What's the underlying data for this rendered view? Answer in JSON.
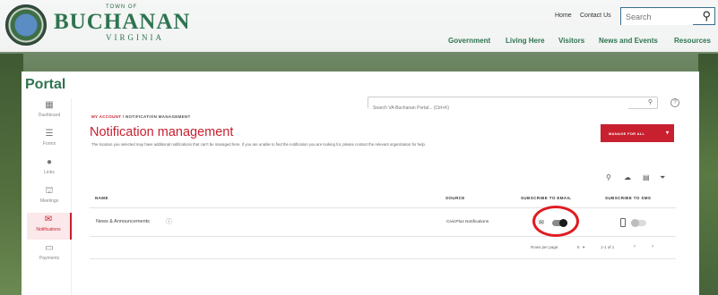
{
  "header": {
    "town_of": "TOWN OF",
    "brand": "BUCHANAN",
    "state": "VIRGINIA",
    "utility": [
      "Home",
      "Contact Us"
    ],
    "search_placeholder": "Search",
    "nav": [
      "Government",
      "Living Here",
      "Visitors",
      "News and Events",
      "Resources"
    ]
  },
  "portal": {
    "title": "Portal",
    "sidebar": [
      {
        "label": "Dashboard",
        "icon": "dashboard-icon",
        "glyph": "▦"
      },
      {
        "label": "Forms",
        "icon": "forms-icon",
        "glyph": "☰"
      },
      {
        "label": "Links",
        "icon": "links-icon",
        "glyph": "●"
      },
      {
        "label": "Meetings",
        "icon": "meetings-icon",
        "glyph": "⛫"
      },
      {
        "label": "Notifications",
        "icon": "notifications-icon",
        "glyph": "✉"
      },
      {
        "label": "Payments",
        "icon": "payments-icon",
        "glyph": "▭"
      }
    ],
    "search_placeholder": "Search VA-Buchanan Portal... (Ctrl+K)",
    "breadcrumb": {
      "parent": "MY ACCOUNT",
      "sep": "/",
      "current": "NOTIFICATION MANAGEMENT"
    },
    "page_title": "Notification management",
    "description": "The location you selected may have additional notifications that can't be managed here. If you are unable to find the notification you are looking for, please contact the relevant organization for help.",
    "manage_button": "MANAGE FOR ALL",
    "table": {
      "headers": [
        "NAME",
        "SOURCE",
        "SUBSCRIBE TO EMAIL",
        "SUBSCRIBE TO SMS"
      ],
      "rows": [
        {
          "name": "News & Announcements",
          "source": "CivicPlus Notifications",
          "email": true,
          "sms": false
        }
      ]
    },
    "pagination": {
      "rows_label": "Rows per page:",
      "rows_value": "5",
      "range": "1-1 of 1"
    }
  },
  "colors": {
    "accent": "#c8202f",
    "brand": "#2e7450",
    "annotation": "#e01b22"
  }
}
